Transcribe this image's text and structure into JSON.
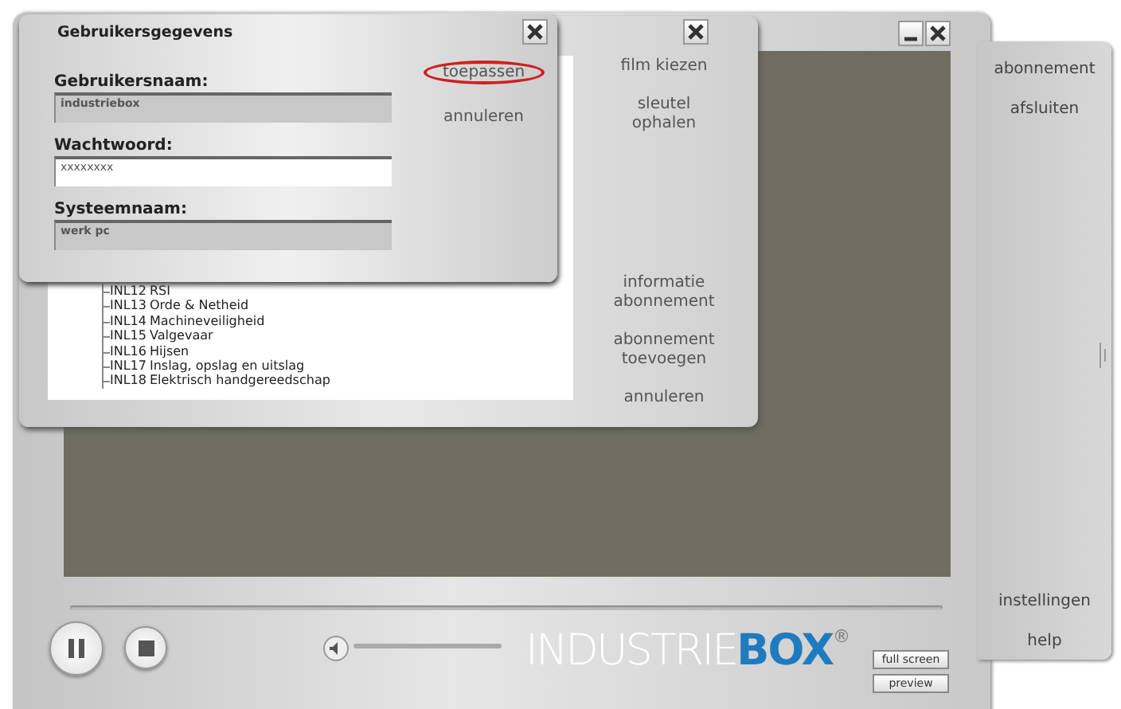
{
  "player": {
    "side_menu_top": [
      "abonnement",
      "afsluiten"
    ],
    "side_menu_bottom": [
      "instellingen",
      "help"
    ],
    "logo": "INDUSTRIE**BOX**$^{®}$",
    "volume": {
      "level": 1
    },
    "view_buttons": [
      "full screen",
      "preview"
    ]
  },
  "film_window": {
    "tree": [
      {
        "code": "INL12",
        "title": "RSI"
      },
      {
        "code": "INL13",
        "title": "Orde & Netheid"
      },
      {
        "code": "INL14",
        "title": "Machineveiligheid"
      },
      {
        "code": "INL15",
        "title": "Valgevaar"
      },
      {
        "code": "INL16",
        "title": "Hijsen"
      },
      {
        "code": "INL17",
        "title": "Inslag, opslag en uitslag"
      },
      {
        "code": "INL18",
        "title": "Elektrisch handgereedschap"
      }
    ],
    "menu_top": [
      "film kiezen",
      "sleutel ophalen"
    ],
    "menu_bottom": [
      "informatie abonnement",
      "abonnement toevoegen",
      "annuleren"
    ]
  },
  "dialog": {
    "title": "Gebruikersgegevens",
    "fields": [
      {
        "label": "Gebruikersnaam:",
        "value": "industriebox",
        "disabled": true
      },
      {
        "label": "Wachtwoord:",
        "value": "xxxxxxxx",
        "disabled": false
      },
      {
        "label": "Systeemnaam:",
        "value": "werk pc",
        "disabled": true
      }
    ],
    "actions": [
      {
        "label": "toepassen",
        "highlighted": true
      },
      {
        "label": "annuleren",
        "highlighted": false
      }
    ]
  }
}
